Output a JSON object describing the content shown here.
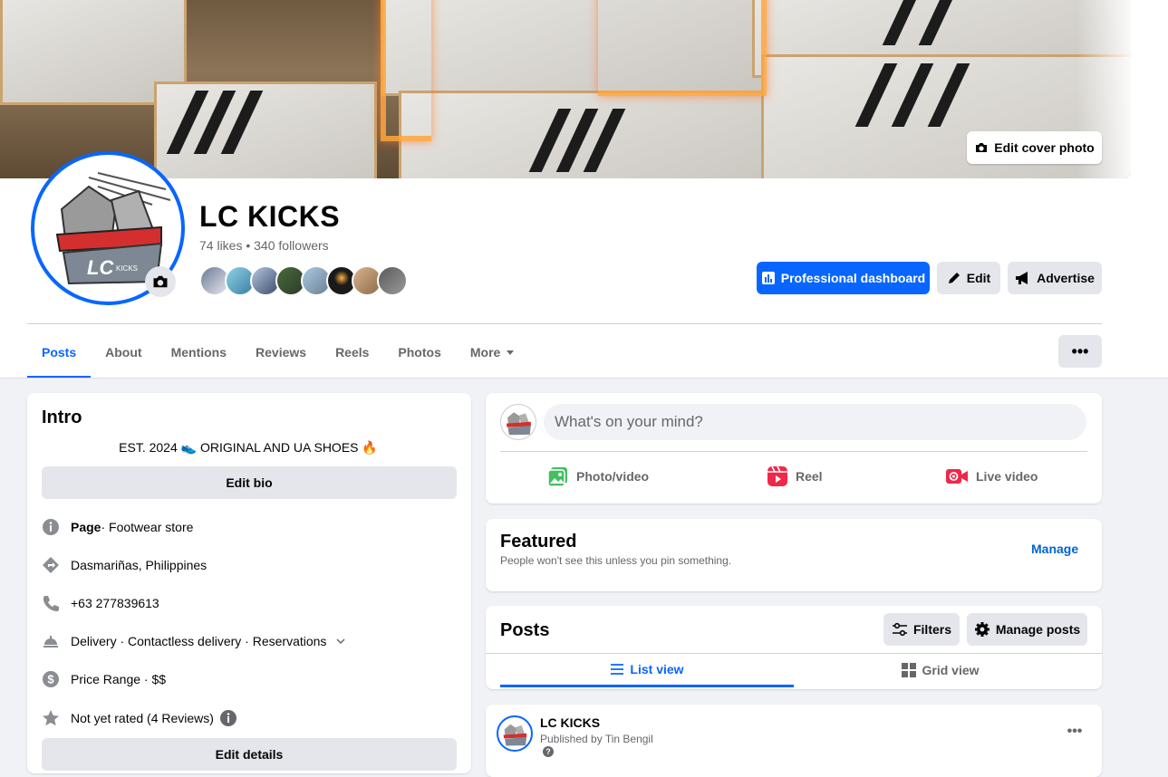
{
  "cover": {
    "edit_cover_label": "Edit cover photo"
  },
  "profile": {
    "name": "LC KICKS",
    "stats": "74 likes • 340 followers",
    "avatar_logo_text": "LC",
    "avatar_logo_sub": "KICKS"
  },
  "actions": {
    "dashboard_label": "Professional dashboard",
    "edit_label": "Edit",
    "advertise_label": "Advertise"
  },
  "tabs": [
    {
      "label": "Posts",
      "active": true
    },
    {
      "label": "About"
    },
    {
      "label": "Mentions"
    },
    {
      "label": "Reviews"
    },
    {
      "label": "Reels"
    },
    {
      "label": "Photos"
    },
    {
      "label": "More"
    }
  ],
  "tabs_more_dots": "•••",
  "intro": {
    "title": "Intro",
    "bio": "EST. 2024 👟 ORIGINAL AND UA SHOES 🔥",
    "edit_bio_label": "Edit bio",
    "page_label": "Page",
    "category": " · Footwear store",
    "location": "Dasmariñas, Philippines",
    "phone": "+63 277839613",
    "services": "Delivery · Contactless delivery · Reservations",
    "price_range": "Price Range · $$",
    "rating": "Not yet rated (4 Reviews)",
    "edit_details_label": "Edit details"
  },
  "composer": {
    "placeholder": "What's on your mind?",
    "photo_video": "Photo/video",
    "reel": "Reel",
    "live_video": "Live video"
  },
  "featured": {
    "title": "Featured",
    "subtitle": "People won't see this unless you pin something.",
    "manage_label": "Manage"
  },
  "posts_section": {
    "title": "Posts",
    "filters_label": "Filters",
    "manage_posts_label": "Manage posts",
    "list_view_label": "List view",
    "grid_view_label": "Grid view"
  },
  "post": {
    "author": "LC KICKS",
    "published_by": "Published by Tin Bengil",
    "help_glyph": "?",
    "more_dots": "•••"
  },
  "colors": {
    "accent": "#0866ff",
    "page_bg": "#f0f2f5",
    "button_grey": "#e4e6eb"
  }
}
